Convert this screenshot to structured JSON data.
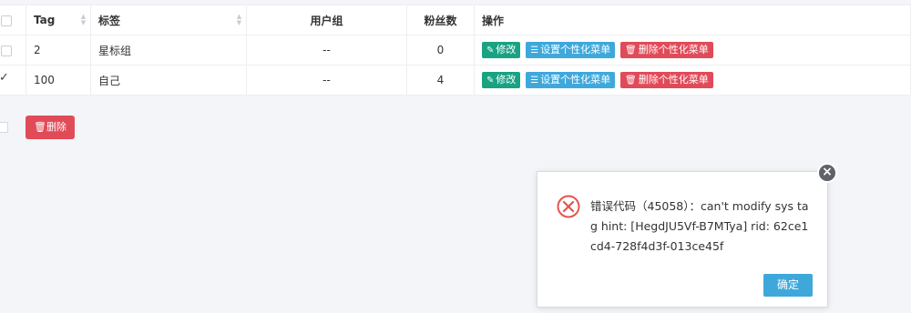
{
  "table": {
    "headers": {
      "tag": "Tag",
      "label": "标签",
      "group": "用户组",
      "fans": "粉丝数",
      "actions": "操作"
    },
    "rows": [
      {
        "checked": false,
        "tag": "2",
        "label": "星标组",
        "group": "--",
        "fans": "0",
        "actions": {
          "edit": "修改",
          "set_menu": "设置个性化菜单",
          "delete_menu": "删除个性化菜单"
        }
      },
      {
        "checked": true,
        "tag": "100",
        "label": "自己",
        "group": "--",
        "fans": "4",
        "actions": {
          "edit": "修改",
          "set_menu": "设置个性化菜单",
          "delete_menu": "删除个性化菜单"
        }
      }
    ]
  },
  "bulk": {
    "delete_label": "删除"
  },
  "dialog": {
    "message": "错误代码（45058）：can't modify sys tag hint: [HegdJU5Vf-B7MTya] rid: 62ce1cd4-728f4d3f-013ce45f",
    "confirm_label": "确定"
  },
  "icons": {
    "edit": "edit-icon",
    "list": "list-icon",
    "trash": "trash-icon",
    "error": "error-circle-icon",
    "close": "close-icon",
    "sort": "sort-icon"
  },
  "colors": {
    "green": "#1aa283",
    "blue": "#3fa8db",
    "red": "#e04b59",
    "error_icon": "#e4544f"
  }
}
